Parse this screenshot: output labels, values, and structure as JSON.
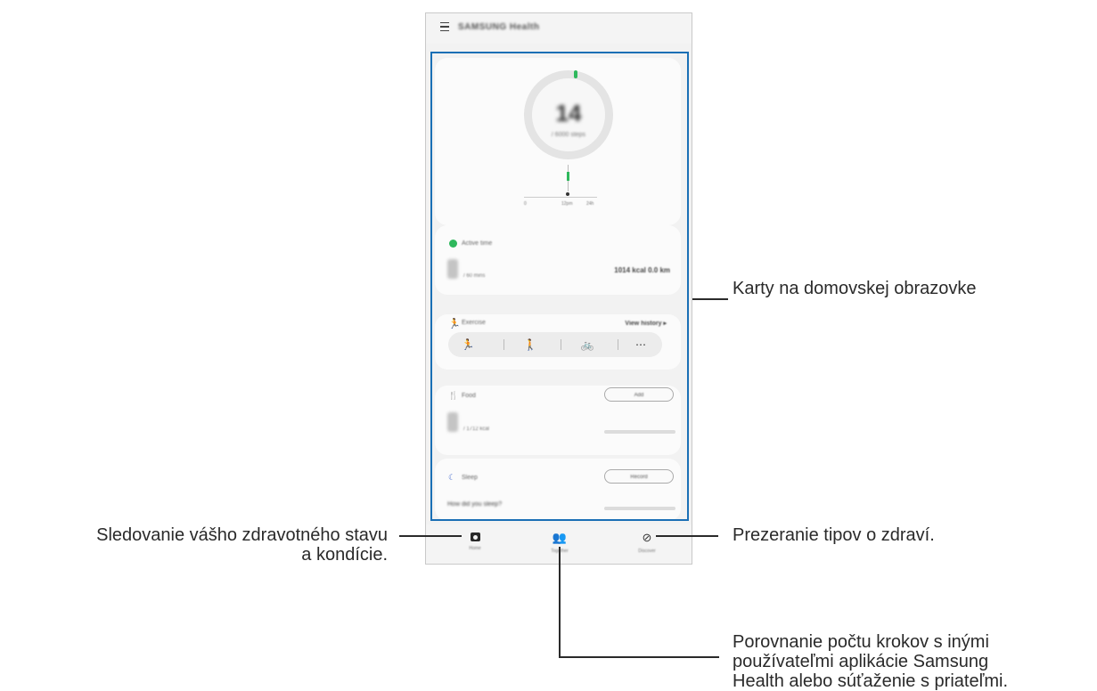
{
  "app": {
    "title": "SAMSUNG Health"
  },
  "steps_card": {
    "value": "14",
    "goal": "/ 6000 steps",
    "ticks": [
      "0",
      "12pm",
      "24h"
    ]
  },
  "active_card": {
    "label": "Active time",
    "unit": "/ 60 mins",
    "stats": "1014 kcal  0.0 km"
  },
  "exercise_card": {
    "label": "Exercise",
    "link": "View history ▸",
    "items": [
      "running-icon",
      "walking-icon",
      "cycling-icon",
      "more-icon"
    ],
    "more_glyph": "⋯"
  },
  "food_card": {
    "label": "Food",
    "button": "Add",
    "unit": "/ 1712 kcal"
  },
  "sleep_card": {
    "label": "Sleep",
    "button": "Record",
    "question": "How did you sleep?"
  },
  "navbar": {
    "items": [
      {
        "label": "Home",
        "icon": "home-icon"
      },
      {
        "label": "Together",
        "icon": "people-icon"
      },
      {
        "label": "Discover",
        "icon": "compass-icon"
      }
    ]
  },
  "callouts": {
    "cards": "Karty na domovskej obrazovke",
    "home_line1": "Sledovanie vášho zdravotného stavu",
    "home_line2": "a kondície.",
    "discover": "Prezeranie tipov o zdraví.",
    "together_line1": "Porovnanie počtu krokov s inými",
    "together_line2": "používateľmi aplikácie Samsung",
    "together_line3": "Health alebo súťaženie s priateľmi."
  },
  "colors": {
    "highlight": "#1a6fb5",
    "accent_green": "#2eb85c",
    "sleep_blue": "#4a6fd0"
  }
}
